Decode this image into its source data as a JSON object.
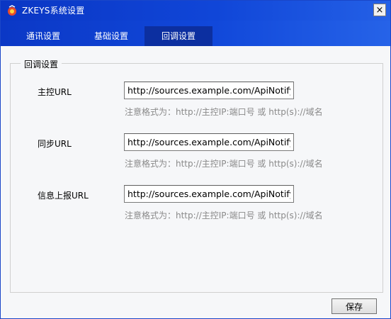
{
  "window": {
    "title": "ZKEYS系统设置",
    "app_icon": "app-logo-icon",
    "close_glyph": "×"
  },
  "tabs": [
    {
      "label": "通讯设置",
      "active": false
    },
    {
      "label": "基础设置",
      "active": false
    },
    {
      "label": "回调设置",
      "active": true
    }
  ],
  "group": {
    "legend": "回调设置"
  },
  "fields": [
    {
      "label": "主控URL",
      "value": "http://sources.example.com/ApiNotify/v",
      "hint": "注意格式为：http://主控IP:端口号 或 http(s)://域名"
    },
    {
      "label": "同步URL",
      "value": "http://sources.example.com/ApiNotify/v",
      "hint": "注意格式为：http://主控IP:端口号 或 http(s)://域名"
    },
    {
      "label": "信息上报URL",
      "value": "http://sources.example.com/ApiNotify/v",
      "hint": "注意格式为：http://主控IP:端口号 或 http(s)://域名"
    }
  ],
  "actions": {
    "save_label": "保存"
  },
  "colors": {
    "titlebar": "#1046d8",
    "active_tab": "#0c2fa0",
    "hint_text": "#8a8a8a"
  }
}
